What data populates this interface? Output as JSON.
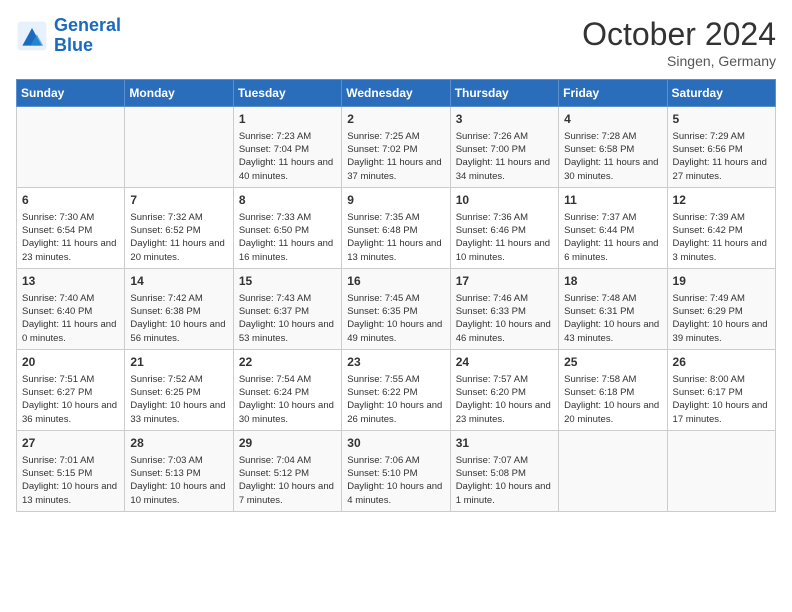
{
  "header": {
    "logo_line1": "General",
    "logo_line2": "Blue",
    "month_title": "October 2024",
    "subtitle": "Singen, Germany"
  },
  "weekdays": [
    "Sunday",
    "Monday",
    "Tuesday",
    "Wednesday",
    "Thursday",
    "Friday",
    "Saturday"
  ],
  "weeks": [
    [
      {
        "day": "",
        "info": ""
      },
      {
        "day": "",
        "info": ""
      },
      {
        "day": "1",
        "info": "Sunrise: 7:23 AM\nSunset: 7:04 PM\nDaylight: 11 hours and 40 minutes."
      },
      {
        "day": "2",
        "info": "Sunrise: 7:25 AM\nSunset: 7:02 PM\nDaylight: 11 hours and 37 minutes."
      },
      {
        "day": "3",
        "info": "Sunrise: 7:26 AM\nSunset: 7:00 PM\nDaylight: 11 hours and 34 minutes."
      },
      {
        "day": "4",
        "info": "Sunrise: 7:28 AM\nSunset: 6:58 PM\nDaylight: 11 hours and 30 minutes."
      },
      {
        "day": "5",
        "info": "Sunrise: 7:29 AM\nSunset: 6:56 PM\nDaylight: 11 hours and 27 minutes."
      }
    ],
    [
      {
        "day": "6",
        "info": "Sunrise: 7:30 AM\nSunset: 6:54 PM\nDaylight: 11 hours and 23 minutes."
      },
      {
        "day": "7",
        "info": "Sunrise: 7:32 AM\nSunset: 6:52 PM\nDaylight: 11 hours and 20 minutes."
      },
      {
        "day": "8",
        "info": "Sunrise: 7:33 AM\nSunset: 6:50 PM\nDaylight: 11 hours and 16 minutes."
      },
      {
        "day": "9",
        "info": "Sunrise: 7:35 AM\nSunset: 6:48 PM\nDaylight: 11 hours and 13 minutes."
      },
      {
        "day": "10",
        "info": "Sunrise: 7:36 AM\nSunset: 6:46 PM\nDaylight: 11 hours and 10 minutes."
      },
      {
        "day": "11",
        "info": "Sunrise: 7:37 AM\nSunset: 6:44 PM\nDaylight: 11 hours and 6 minutes."
      },
      {
        "day": "12",
        "info": "Sunrise: 7:39 AM\nSunset: 6:42 PM\nDaylight: 11 hours and 3 minutes."
      }
    ],
    [
      {
        "day": "13",
        "info": "Sunrise: 7:40 AM\nSunset: 6:40 PM\nDaylight: 11 hours and 0 minutes."
      },
      {
        "day": "14",
        "info": "Sunrise: 7:42 AM\nSunset: 6:38 PM\nDaylight: 10 hours and 56 minutes."
      },
      {
        "day": "15",
        "info": "Sunrise: 7:43 AM\nSunset: 6:37 PM\nDaylight: 10 hours and 53 minutes."
      },
      {
        "day": "16",
        "info": "Sunrise: 7:45 AM\nSunset: 6:35 PM\nDaylight: 10 hours and 49 minutes."
      },
      {
        "day": "17",
        "info": "Sunrise: 7:46 AM\nSunset: 6:33 PM\nDaylight: 10 hours and 46 minutes."
      },
      {
        "day": "18",
        "info": "Sunrise: 7:48 AM\nSunset: 6:31 PM\nDaylight: 10 hours and 43 minutes."
      },
      {
        "day": "19",
        "info": "Sunrise: 7:49 AM\nSunset: 6:29 PM\nDaylight: 10 hours and 39 minutes."
      }
    ],
    [
      {
        "day": "20",
        "info": "Sunrise: 7:51 AM\nSunset: 6:27 PM\nDaylight: 10 hours and 36 minutes."
      },
      {
        "day": "21",
        "info": "Sunrise: 7:52 AM\nSunset: 6:25 PM\nDaylight: 10 hours and 33 minutes."
      },
      {
        "day": "22",
        "info": "Sunrise: 7:54 AM\nSunset: 6:24 PM\nDaylight: 10 hours and 30 minutes."
      },
      {
        "day": "23",
        "info": "Sunrise: 7:55 AM\nSunset: 6:22 PM\nDaylight: 10 hours and 26 minutes."
      },
      {
        "day": "24",
        "info": "Sunrise: 7:57 AM\nSunset: 6:20 PM\nDaylight: 10 hours and 23 minutes."
      },
      {
        "day": "25",
        "info": "Sunrise: 7:58 AM\nSunset: 6:18 PM\nDaylight: 10 hours and 20 minutes."
      },
      {
        "day": "26",
        "info": "Sunrise: 8:00 AM\nSunset: 6:17 PM\nDaylight: 10 hours and 17 minutes."
      }
    ],
    [
      {
        "day": "27",
        "info": "Sunrise: 7:01 AM\nSunset: 5:15 PM\nDaylight: 10 hours and 13 minutes."
      },
      {
        "day": "28",
        "info": "Sunrise: 7:03 AM\nSunset: 5:13 PM\nDaylight: 10 hours and 10 minutes."
      },
      {
        "day": "29",
        "info": "Sunrise: 7:04 AM\nSunset: 5:12 PM\nDaylight: 10 hours and 7 minutes."
      },
      {
        "day": "30",
        "info": "Sunrise: 7:06 AM\nSunset: 5:10 PM\nDaylight: 10 hours and 4 minutes."
      },
      {
        "day": "31",
        "info": "Sunrise: 7:07 AM\nSunset: 5:08 PM\nDaylight: 10 hours and 1 minute."
      },
      {
        "day": "",
        "info": ""
      },
      {
        "day": "",
        "info": ""
      }
    ]
  ]
}
